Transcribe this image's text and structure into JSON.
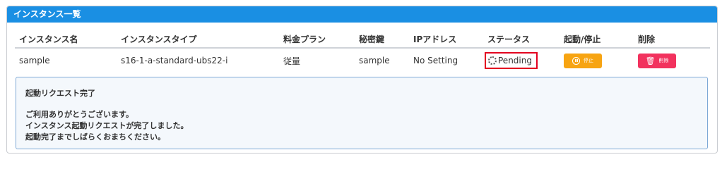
{
  "panel": {
    "title": "インスタンス一覧"
  },
  "table": {
    "headers": [
      "インスタンス名",
      "インスタンスタイプ",
      "料金プラン",
      "秘密鍵",
      "IPアドレス",
      "ステータス",
      "起動/停止",
      "削除"
    ],
    "rows": [
      {
        "name": "sample",
        "type": "s16-1-a-standard-ubs22-i",
        "plan": "従量",
        "key": "sample",
        "ip": "No Setting",
        "status": "Pending",
        "stop_label": "停止",
        "delete_label": "削除"
      }
    ]
  },
  "message": {
    "title": "起動リクエスト完了",
    "lines": [
      "ご利用ありがとうございます。",
      "インスタンス起動リクエストが完了しました。",
      "起動完了までしばらくおまちください。"
    ]
  },
  "colors": {
    "header": "#1a8fe3",
    "stop_button": "#f7a412",
    "delete_button": "#f2325e",
    "status_highlight": "#e3001f"
  },
  "icons": {
    "status": "spinner-icon",
    "stop": "pause-circle-icon",
    "delete": "trash-icon"
  }
}
